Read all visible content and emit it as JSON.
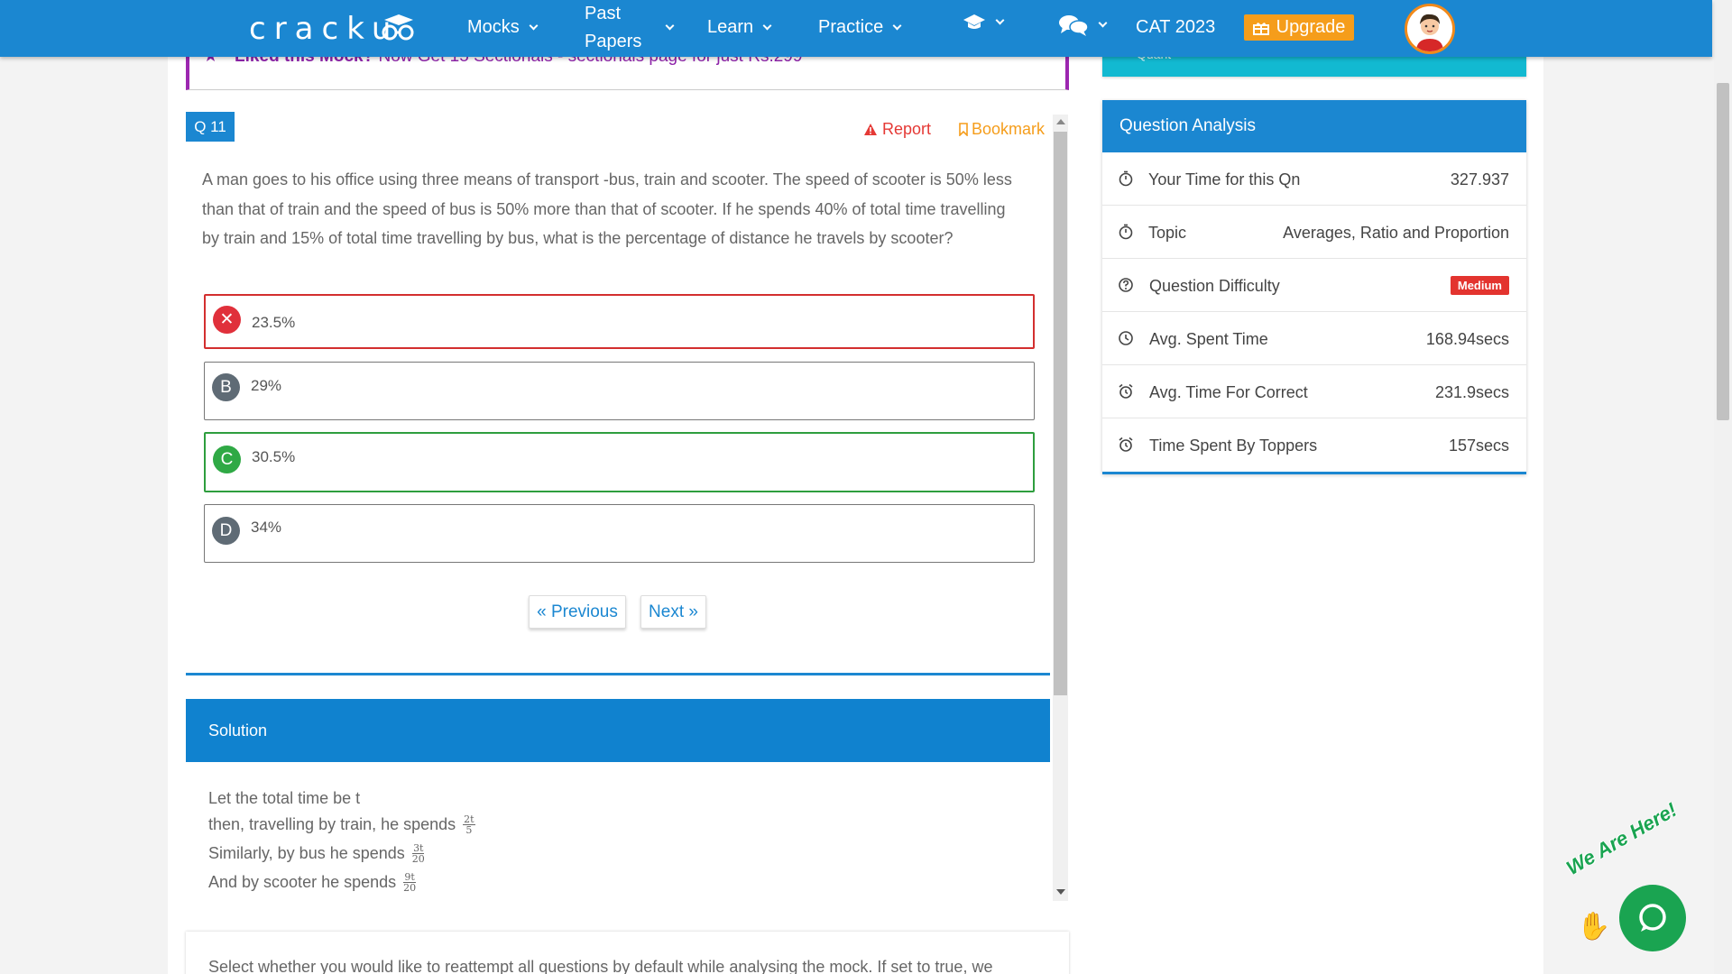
{
  "navbar": {
    "logo": "cracku",
    "items": [
      {
        "label": "Mocks"
      },
      {
        "label_line1": "Past",
        "label_line2": "Papers"
      },
      {
        "label": "Learn"
      },
      {
        "label": "Practice"
      }
    ],
    "cat": "CAT 2023",
    "upgrade": "Upgrade"
  },
  "promo": {
    "bold": "Liked this Mock?",
    "text": " Now Get 15 Sectionals - sectionals page for just Rs.299"
  },
  "question": {
    "badge": "Q 11",
    "report": "Report",
    "bookmark": "Bookmark",
    "text": "A man goes to his office using three means of transport -bus, train and scooter. The speed of scooter is 50% less than that of train and the speed of bus is 50% more than that of scooter. If he spends 40% of total time travelling by train and 15% of total time travelling by bus, what is the percentage of distance he travels by scooter?",
    "options": [
      {
        "marker": "✕",
        "label": "23.5%",
        "state": "wrong"
      },
      {
        "marker": "B",
        "label": "29%",
        "state": "normal"
      },
      {
        "marker": "C",
        "label": "30.5%",
        "state": "right"
      },
      {
        "marker": "D",
        "label": "34%",
        "state": "normal"
      }
    ],
    "previous": "« Previous",
    "next": "Next »"
  },
  "solution": {
    "header": "Solution",
    "lines": [
      {
        "text": "Let the total time be t"
      },
      {
        "text": "then, travelling by train, he spends",
        "num": "2t",
        "den": "5"
      },
      {
        "text": "Similarly, by bus he spends",
        "num": "3t",
        "den": "20"
      },
      {
        "text": "And by scooter he spends",
        "num": "9t",
        "den": "20"
      }
    ]
  },
  "bottom_text": "Select whether you would like to reattempt all questions by default while analysing the mock. If set to true, we",
  "cyan_bar_text": "Quant",
  "analysis": {
    "header": "Question Analysis",
    "rows": [
      {
        "icon": "stopwatch-icon",
        "label": "Your Time for this Qn",
        "value": "327.937"
      },
      {
        "icon": "stopwatch-icon",
        "label": "Topic",
        "value": "Averages, Ratio and Proportion"
      },
      {
        "icon": "question-circle-icon",
        "label": "Question Difficulty",
        "badge": "Medium"
      },
      {
        "icon": "clock-icon",
        "label": "Avg. Spent Time",
        "value": "168.94secs"
      },
      {
        "icon": "alarm-clock-icon",
        "label": "Avg. Time For Correct",
        "value": "231.9secs"
      },
      {
        "icon": "alarm-clock-icon",
        "label": "Time Spent By Toppers",
        "value": "157secs"
      }
    ]
  },
  "chat": {
    "tagline": "We Are Here!"
  },
  "colors": {
    "primary": "#1b87d1",
    "upgrade": "#f59d1b",
    "wrong": "#e0303b",
    "right": "#2fa945",
    "promo": "#9c27b0",
    "cyan": "#12b9d1"
  }
}
